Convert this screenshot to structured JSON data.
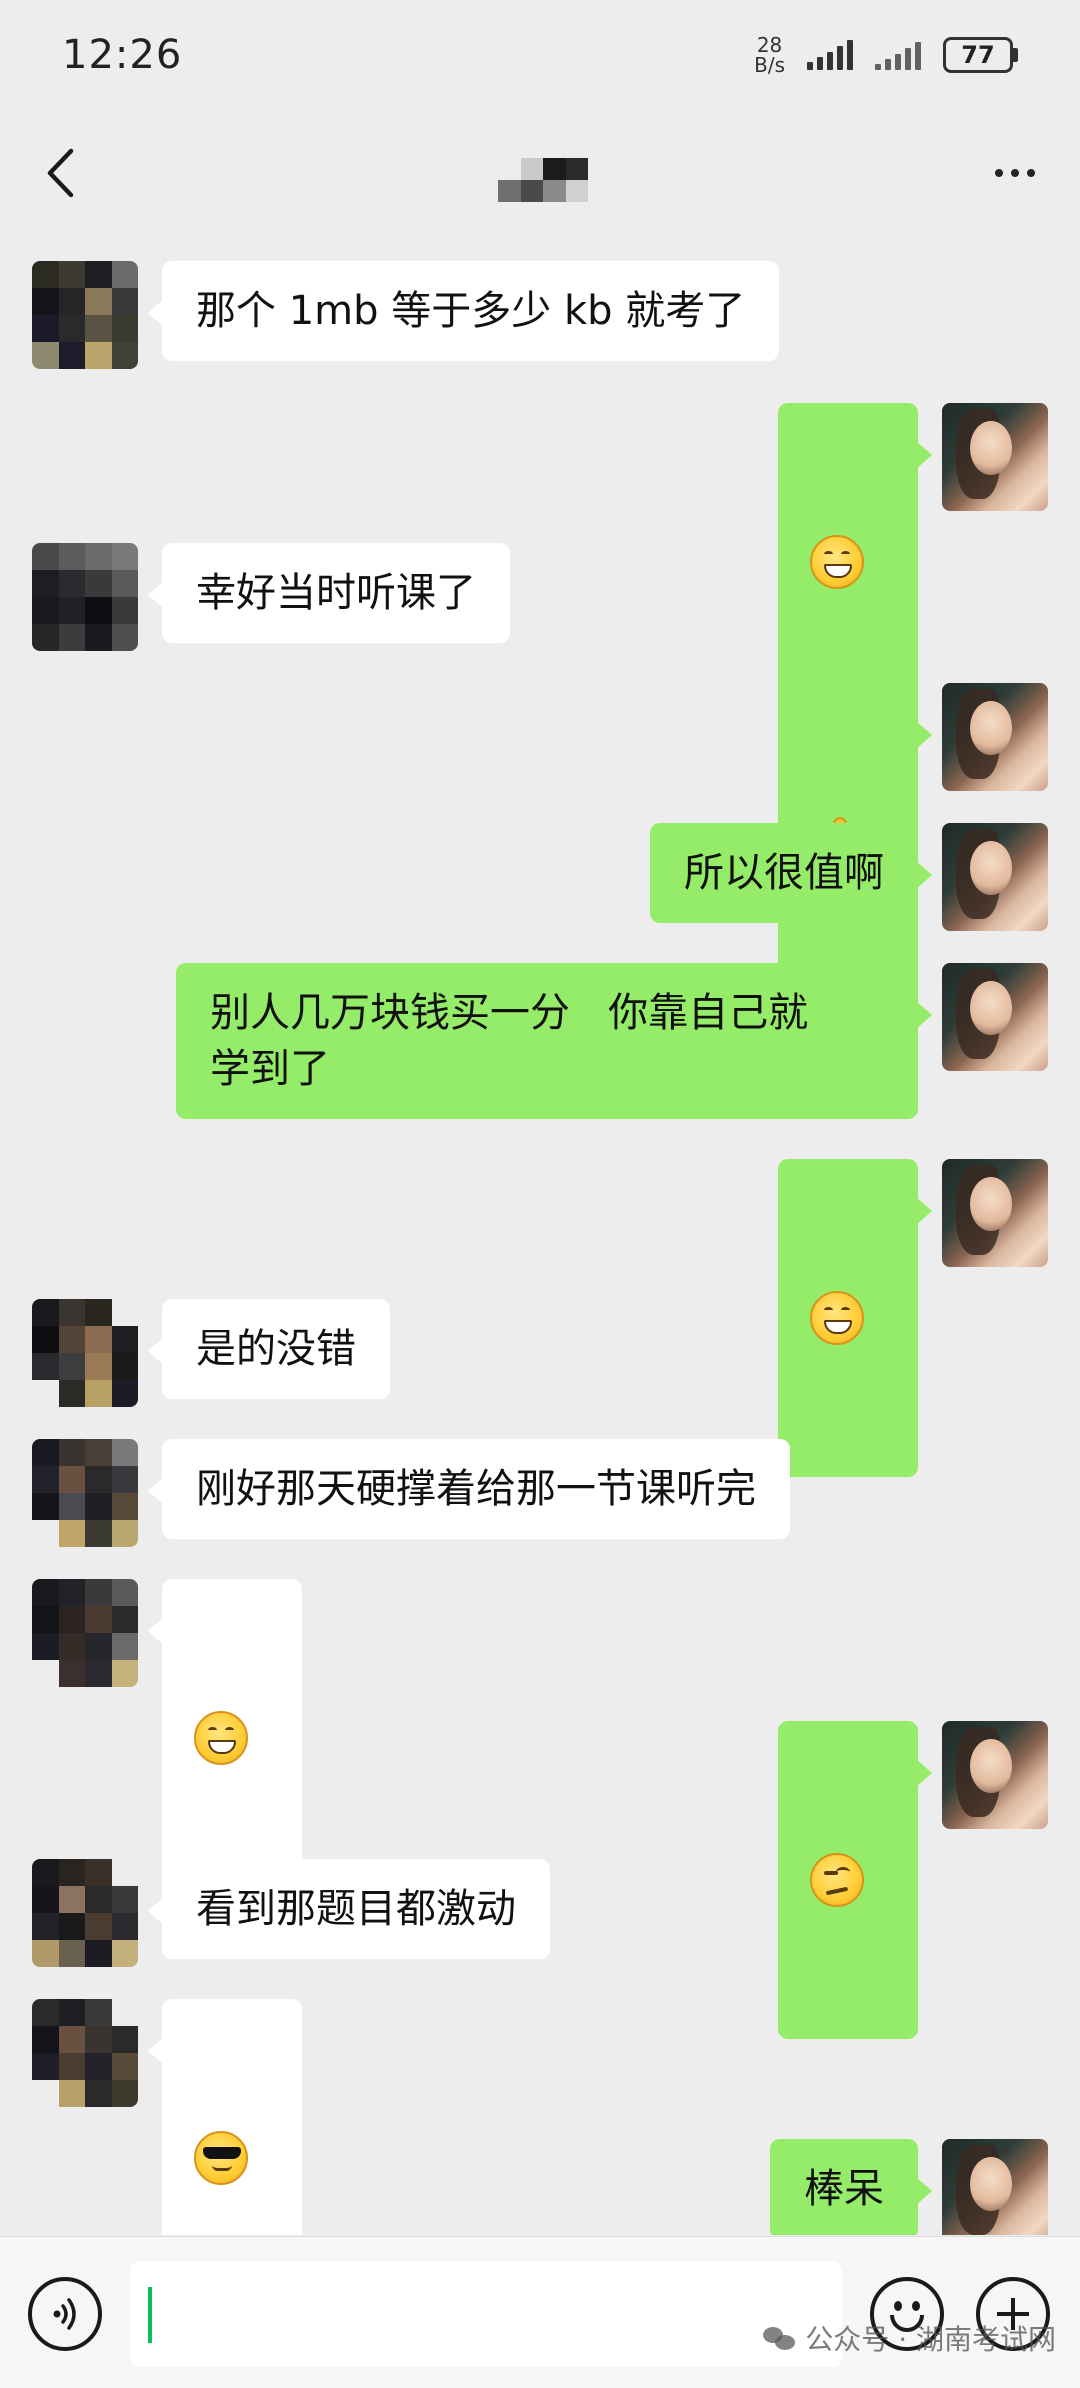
{
  "status_bar": {
    "time": "12:26",
    "net_speed_value": "28",
    "net_speed_unit": "B/s",
    "battery": "77"
  },
  "header": {
    "title_hidden": true,
    "more_label": "···"
  },
  "messages": [
    {
      "side": "left",
      "type": "text",
      "text": "那个 1mb 等于多少 kb 就考了"
    },
    {
      "side": "right",
      "type": "emoji",
      "emoji": "grin"
    },
    {
      "side": "left",
      "type": "text",
      "text": "幸好当时听课了"
    },
    {
      "side": "right",
      "type": "emoji",
      "emoji": "thumbs-up"
    },
    {
      "side": "right",
      "type": "text",
      "text": "所以很值啊"
    },
    {
      "side": "right",
      "type": "text",
      "text": "别人几万块钱买一分   你靠自己就\n学到了"
    },
    {
      "side": "right",
      "type": "emoji",
      "emoji": "grin"
    },
    {
      "side": "left",
      "type": "text",
      "text": "是的没错"
    },
    {
      "side": "left",
      "type": "text",
      "text": "刚好那天硬撑着给那一节课听完"
    },
    {
      "side": "left",
      "type": "emoji",
      "emoji": "grin"
    },
    {
      "side": "right",
      "type": "emoji",
      "emoji": "smirk"
    },
    {
      "side": "left",
      "type": "text",
      "text": "看到那题目都激动"
    },
    {
      "side": "left",
      "type": "emoji",
      "emoji": "cool"
    },
    {
      "side": "right",
      "type": "text",
      "text": "棒呆"
    }
  ],
  "input_bar": {
    "voice_icon": "voice-icon",
    "emoji_icon": "emoji-icon",
    "plus_icon": "plus-icon"
  },
  "watermark": {
    "text": "公众号 · 湖南考试网"
  },
  "colors": {
    "background": "#ededed",
    "self_bubble": "#95ec69",
    "other_bubble": "#ffffff",
    "caret": "#07c160"
  }
}
